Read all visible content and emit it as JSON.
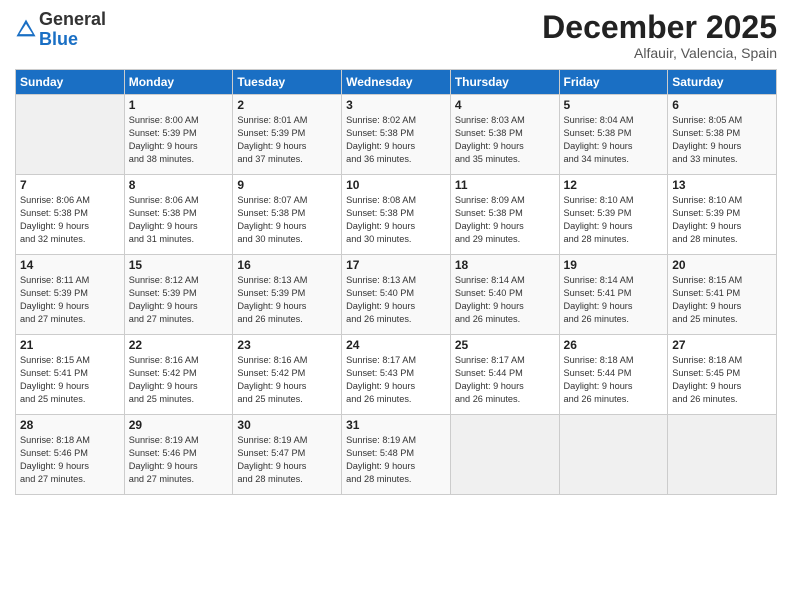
{
  "logo": {
    "general": "General",
    "blue": "Blue"
  },
  "header": {
    "month": "December 2025",
    "location": "Alfauir, Valencia, Spain"
  },
  "weekdays": [
    "Sunday",
    "Monday",
    "Tuesday",
    "Wednesday",
    "Thursday",
    "Friday",
    "Saturday"
  ],
  "weeks": [
    [
      {
        "day": "",
        "info": ""
      },
      {
        "day": "1",
        "info": "Sunrise: 8:00 AM\nSunset: 5:39 PM\nDaylight: 9 hours\nand 38 minutes."
      },
      {
        "day": "2",
        "info": "Sunrise: 8:01 AM\nSunset: 5:39 PM\nDaylight: 9 hours\nand 37 minutes."
      },
      {
        "day": "3",
        "info": "Sunrise: 8:02 AM\nSunset: 5:38 PM\nDaylight: 9 hours\nand 36 minutes."
      },
      {
        "day": "4",
        "info": "Sunrise: 8:03 AM\nSunset: 5:38 PM\nDaylight: 9 hours\nand 35 minutes."
      },
      {
        "day": "5",
        "info": "Sunrise: 8:04 AM\nSunset: 5:38 PM\nDaylight: 9 hours\nand 34 minutes."
      },
      {
        "day": "6",
        "info": "Sunrise: 8:05 AM\nSunset: 5:38 PM\nDaylight: 9 hours\nand 33 minutes."
      }
    ],
    [
      {
        "day": "7",
        "info": "Sunrise: 8:06 AM\nSunset: 5:38 PM\nDaylight: 9 hours\nand 32 minutes."
      },
      {
        "day": "8",
        "info": "Sunrise: 8:06 AM\nSunset: 5:38 PM\nDaylight: 9 hours\nand 31 minutes."
      },
      {
        "day": "9",
        "info": "Sunrise: 8:07 AM\nSunset: 5:38 PM\nDaylight: 9 hours\nand 30 minutes."
      },
      {
        "day": "10",
        "info": "Sunrise: 8:08 AM\nSunset: 5:38 PM\nDaylight: 9 hours\nand 30 minutes."
      },
      {
        "day": "11",
        "info": "Sunrise: 8:09 AM\nSunset: 5:38 PM\nDaylight: 9 hours\nand 29 minutes."
      },
      {
        "day": "12",
        "info": "Sunrise: 8:10 AM\nSunset: 5:39 PM\nDaylight: 9 hours\nand 28 minutes."
      },
      {
        "day": "13",
        "info": "Sunrise: 8:10 AM\nSunset: 5:39 PM\nDaylight: 9 hours\nand 28 minutes."
      }
    ],
    [
      {
        "day": "14",
        "info": "Sunrise: 8:11 AM\nSunset: 5:39 PM\nDaylight: 9 hours\nand 27 minutes."
      },
      {
        "day": "15",
        "info": "Sunrise: 8:12 AM\nSunset: 5:39 PM\nDaylight: 9 hours\nand 27 minutes."
      },
      {
        "day": "16",
        "info": "Sunrise: 8:13 AM\nSunset: 5:39 PM\nDaylight: 9 hours\nand 26 minutes."
      },
      {
        "day": "17",
        "info": "Sunrise: 8:13 AM\nSunset: 5:40 PM\nDaylight: 9 hours\nand 26 minutes."
      },
      {
        "day": "18",
        "info": "Sunrise: 8:14 AM\nSunset: 5:40 PM\nDaylight: 9 hours\nand 26 minutes."
      },
      {
        "day": "19",
        "info": "Sunrise: 8:14 AM\nSunset: 5:41 PM\nDaylight: 9 hours\nand 26 minutes."
      },
      {
        "day": "20",
        "info": "Sunrise: 8:15 AM\nSunset: 5:41 PM\nDaylight: 9 hours\nand 25 minutes."
      }
    ],
    [
      {
        "day": "21",
        "info": "Sunrise: 8:15 AM\nSunset: 5:41 PM\nDaylight: 9 hours\nand 25 minutes."
      },
      {
        "day": "22",
        "info": "Sunrise: 8:16 AM\nSunset: 5:42 PM\nDaylight: 9 hours\nand 25 minutes."
      },
      {
        "day": "23",
        "info": "Sunrise: 8:16 AM\nSunset: 5:42 PM\nDaylight: 9 hours\nand 25 minutes."
      },
      {
        "day": "24",
        "info": "Sunrise: 8:17 AM\nSunset: 5:43 PM\nDaylight: 9 hours\nand 26 minutes."
      },
      {
        "day": "25",
        "info": "Sunrise: 8:17 AM\nSunset: 5:44 PM\nDaylight: 9 hours\nand 26 minutes."
      },
      {
        "day": "26",
        "info": "Sunrise: 8:18 AM\nSunset: 5:44 PM\nDaylight: 9 hours\nand 26 minutes."
      },
      {
        "day": "27",
        "info": "Sunrise: 8:18 AM\nSunset: 5:45 PM\nDaylight: 9 hours\nand 26 minutes."
      }
    ],
    [
      {
        "day": "28",
        "info": "Sunrise: 8:18 AM\nSunset: 5:46 PM\nDaylight: 9 hours\nand 27 minutes."
      },
      {
        "day": "29",
        "info": "Sunrise: 8:19 AM\nSunset: 5:46 PM\nDaylight: 9 hours\nand 27 minutes."
      },
      {
        "day": "30",
        "info": "Sunrise: 8:19 AM\nSunset: 5:47 PM\nDaylight: 9 hours\nand 28 minutes."
      },
      {
        "day": "31",
        "info": "Sunrise: 8:19 AM\nSunset: 5:48 PM\nDaylight: 9 hours\nand 28 minutes."
      },
      {
        "day": "",
        "info": ""
      },
      {
        "day": "",
        "info": ""
      },
      {
        "day": "",
        "info": ""
      }
    ]
  ]
}
